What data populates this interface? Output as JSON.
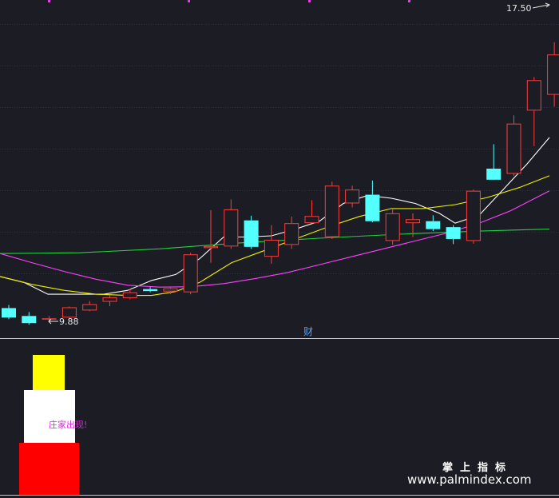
{
  "chart_data": {
    "type": "candlestick",
    "price_range": [
      9.5,
      18.0
    ],
    "max_label": "17.50",
    "min_label": "9.88",
    "candles": [
      {
        "o": 10.2,
        "h": 10.28,
        "l": 9.92,
        "c": 9.96,
        "color": "cyan"
      },
      {
        "o": 10.0,
        "h": 10.1,
        "l": 9.78,
        "c": 9.82,
        "color": "cyan"
      },
      {
        "o": 9.93,
        "h": 10.0,
        "l": 9.88,
        "c": 9.94,
        "color": "red"
      },
      {
        "o": 9.96,
        "h": 10.24,
        "l": 9.92,
        "c": 10.22,
        "color": "red"
      },
      {
        "o": 10.14,
        "h": 10.38,
        "l": 10.12,
        "c": 10.3,
        "color": "red"
      },
      {
        "o": 10.36,
        "h": 10.52,
        "l": 10.25,
        "c": 10.47,
        "color": "red"
      },
      {
        "o": 10.45,
        "h": 10.68,
        "l": 10.42,
        "c": 10.6,
        "color": "red"
      },
      {
        "o": 10.68,
        "h": 10.73,
        "l": 10.6,
        "c": 10.63,
        "color": "cyan"
      },
      {
        "o": 10.62,
        "h": 10.73,
        "l": 10.55,
        "c": 10.7,
        "color": "red"
      },
      {
        "o": 10.6,
        "h": 11.6,
        "l": 10.55,
        "c": 11.56,
        "color": "red"
      },
      {
        "o": 11.72,
        "h": 12.68,
        "l": 11.35,
        "c": 11.77,
        "color": "red"
      },
      {
        "o": 11.76,
        "h": 12.95,
        "l": 11.7,
        "c": 12.7,
        "color": "red"
      },
      {
        "o": 12.42,
        "h": 12.54,
        "l": 11.7,
        "c": 11.75,
        "color": "cyan"
      },
      {
        "o": 11.5,
        "h": 12.3,
        "l": 11.32,
        "c": 11.93,
        "color": "red"
      },
      {
        "o": 11.8,
        "h": 12.52,
        "l": 11.7,
        "c": 12.35,
        "color": "red"
      },
      {
        "o": 12.35,
        "h": 12.93,
        "l": 12.35,
        "c": 12.53,
        "color": "red"
      },
      {
        "o": 12.0,
        "h": 13.4,
        "l": 11.95,
        "c": 13.3,
        "color": "red"
      },
      {
        "o": 12.85,
        "h": 13.3,
        "l": 12.75,
        "c": 13.2,
        "color": "red"
      },
      {
        "o": 13.07,
        "h": 13.43,
        "l": 12.37,
        "c": 12.4,
        "color": "cyan"
      },
      {
        "o": 11.9,
        "h": 12.7,
        "l": 11.8,
        "c": 12.6,
        "color": "red"
      },
      {
        "o": 12.35,
        "h": 12.6,
        "l": 12.0,
        "c": 12.45,
        "color": "red"
      },
      {
        "o": 12.4,
        "h": 12.55,
        "l": 12.15,
        "c": 12.2,
        "color": "cyan"
      },
      {
        "o": 12.25,
        "h": 12.3,
        "l": 11.82,
        "c": 11.95,
        "color": "cyan"
      },
      {
        "o": 11.9,
        "h": 13.2,
        "l": 11.83,
        "c": 13.17,
        "color": "red"
      },
      {
        "o": 13.73,
        "h": 14.35,
        "l": 13.6,
        "c": 13.45,
        "color": "cyan"
      },
      {
        "o": 13.6,
        "h": 15.08,
        "l": 13.55,
        "c": 14.87,
        "color": "red"
      },
      {
        "o": 15.2,
        "h": 16.05,
        "l": 14.3,
        "c": 15.97,
        "color": "red"
      },
      {
        "o": 15.6,
        "h": 16.93,
        "l": 15.3,
        "c": 16.62,
        "color": "red"
      }
    ],
    "ma_lines": [
      {
        "color": "#ffffff",
        "points": [
          [
            0,
            11.0
          ],
          [
            30,
            10.85
          ],
          [
            60,
            10.55
          ],
          [
            100,
            10.55
          ],
          [
            130,
            10.55
          ],
          [
            160,
            10.65
          ],
          [
            190,
            10.9
          ],
          [
            220,
            11.05
          ],
          [
            250,
            11.45
          ],
          [
            280,
            12.0
          ],
          [
            310,
            12.0
          ],
          [
            340,
            12.03
          ],
          [
            370,
            12.2
          ],
          [
            400,
            12.4
          ],
          [
            430,
            12.85
          ],
          [
            460,
            13.05
          ],
          [
            490,
            12.98
          ],
          [
            520,
            12.85
          ],
          [
            550,
            12.6
          ],
          [
            570,
            12.35
          ],
          [
            600,
            12.55
          ],
          [
            630,
            13.2
          ],
          [
            660,
            13.85
          ],
          [
            688,
            14.52
          ]
        ]
      },
      {
        "color": "#f0f000",
        "points": [
          [
            0,
            11.0
          ],
          [
            40,
            10.8
          ],
          [
            80,
            10.65
          ],
          [
            120,
            10.55
          ],
          [
            160,
            10.52
          ],
          [
            190,
            10.52
          ],
          [
            220,
            10.62
          ],
          [
            250,
            10.85
          ],
          [
            290,
            11.35
          ],
          [
            330,
            11.65
          ],
          [
            370,
            11.95
          ],
          [
            410,
            12.25
          ],
          [
            450,
            12.52
          ],
          [
            490,
            12.72
          ],
          [
            530,
            12.72
          ],
          [
            570,
            12.82
          ],
          [
            610,
            13.0
          ],
          [
            650,
            13.25
          ],
          [
            688,
            13.55
          ]
        ]
      },
      {
        "color": "#ff40ff",
        "points": [
          [
            0,
            11.58
          ],
          [
            40,
            11.35
          ],
          [
            80,
            11.13
          ],
          [
            120,
            10.93
          ],
          [
            160,
            10.78
          ],
          [
            200,
            10.73
          ],
          [
            240,
            10.74
          ],
          [
            280,
            10.82
          ],
          [
            320,
            10.95
          ],
          [
            360,
            11.1
          ],
          [
            400,
            11.3
          ],
          [
            440,
            11.5
          ],
          [
            480,
            11.7
          ],
          [
            520,
            11.9
          ],
          [
            560,
            12.1
          ],
          [
            600,
            12.35
          ],
          [
            640,
            12.67
          ],
          [
            688,
            13.17
          ]
        ]
      },
      {
        "color": "#22d040",
        "points": [
          [
            0,
            11.58
          ],
          [
            100,
            11.6
          ],
          [
            200,
            11.7
          ],
          [
            300,
            11.85
          ],
          [
            400,
            11.97
          ],
          [
            500,
            12.07
          ],
          [
            600,
            12.15
          ],
          [
            688,
            12.2
          ]
        ]
      }
    ]
  },
  "axis_label": "财",
  "indicator_panel": {
    "bars": [
      {
        "color": "#ffff00"
      },
      {
        "color": "#ffffff"
      },
      {
        "color": "#ff0000"
      }
    ],
    "signal_text": "庄家出现!"
  },
  "watermark": {
    "title": "掌上指标",
    "url": "www.palmindex.com"
  }
}
